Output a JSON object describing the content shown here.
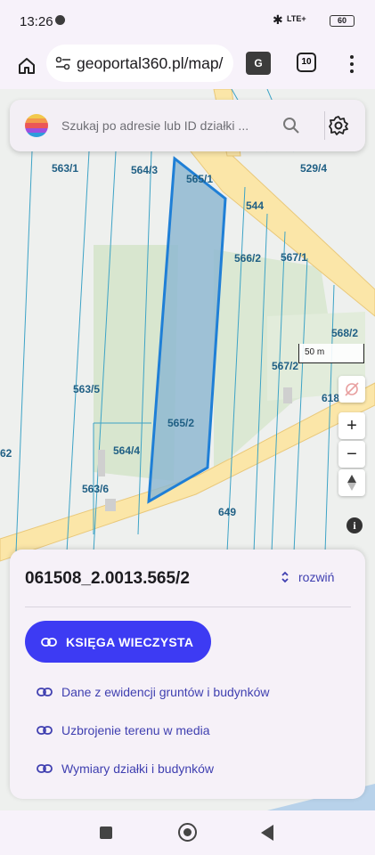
{
  "status_bar": {
    "time": "13:26",
    "network": "LTE+",
    "battery": "60"
  },
  "browser": {
    "url": "geoportal360.pl/map/",
    "tabs_count": "10",
    "translate_label": "G"
  },
  "search": {
    "placeholder": "Szukaj po adresie lub ID działki ..."
  },
  "map": {
    "scale_label": "50 m",
    "parcel_labels": [
      "563/1",
      "564/3",
      "565/1",
      "529/4",
      "544",
      "566/2",
      "567/1",
      "568/2",
      "567/2",
      "618",
      "563/5",
      "565/2",
      "564/4",
      "563/6",
      "649",
      "62"
    ],
    "colors": {
      "selected_parcel_fill": "#8fb9d1",
      "selected_parcel_border": "#1f7fd6",
      "road": "#fbe6a8",
      "green_area": "#d8e8cf"
    }
  },
  "map_controls": {
    "zoom_in": "+",
    "zoom_out": "−",
    "info": "i"
  },
  "sheet": {
    "parcel_id": "061508_2.0013.565/2",
    "expand_label": "rozwiń",
    "primary_button": "KSIĘGA WIECZYSTA",
    "links": [
      "Dane z ewidencji gruntów i budynków",
      "Uzbrojenie terenu w media",
      "Wymiary działki i budynków"
    ],
    "accent_color": "#3d3bf3"
  }
}
